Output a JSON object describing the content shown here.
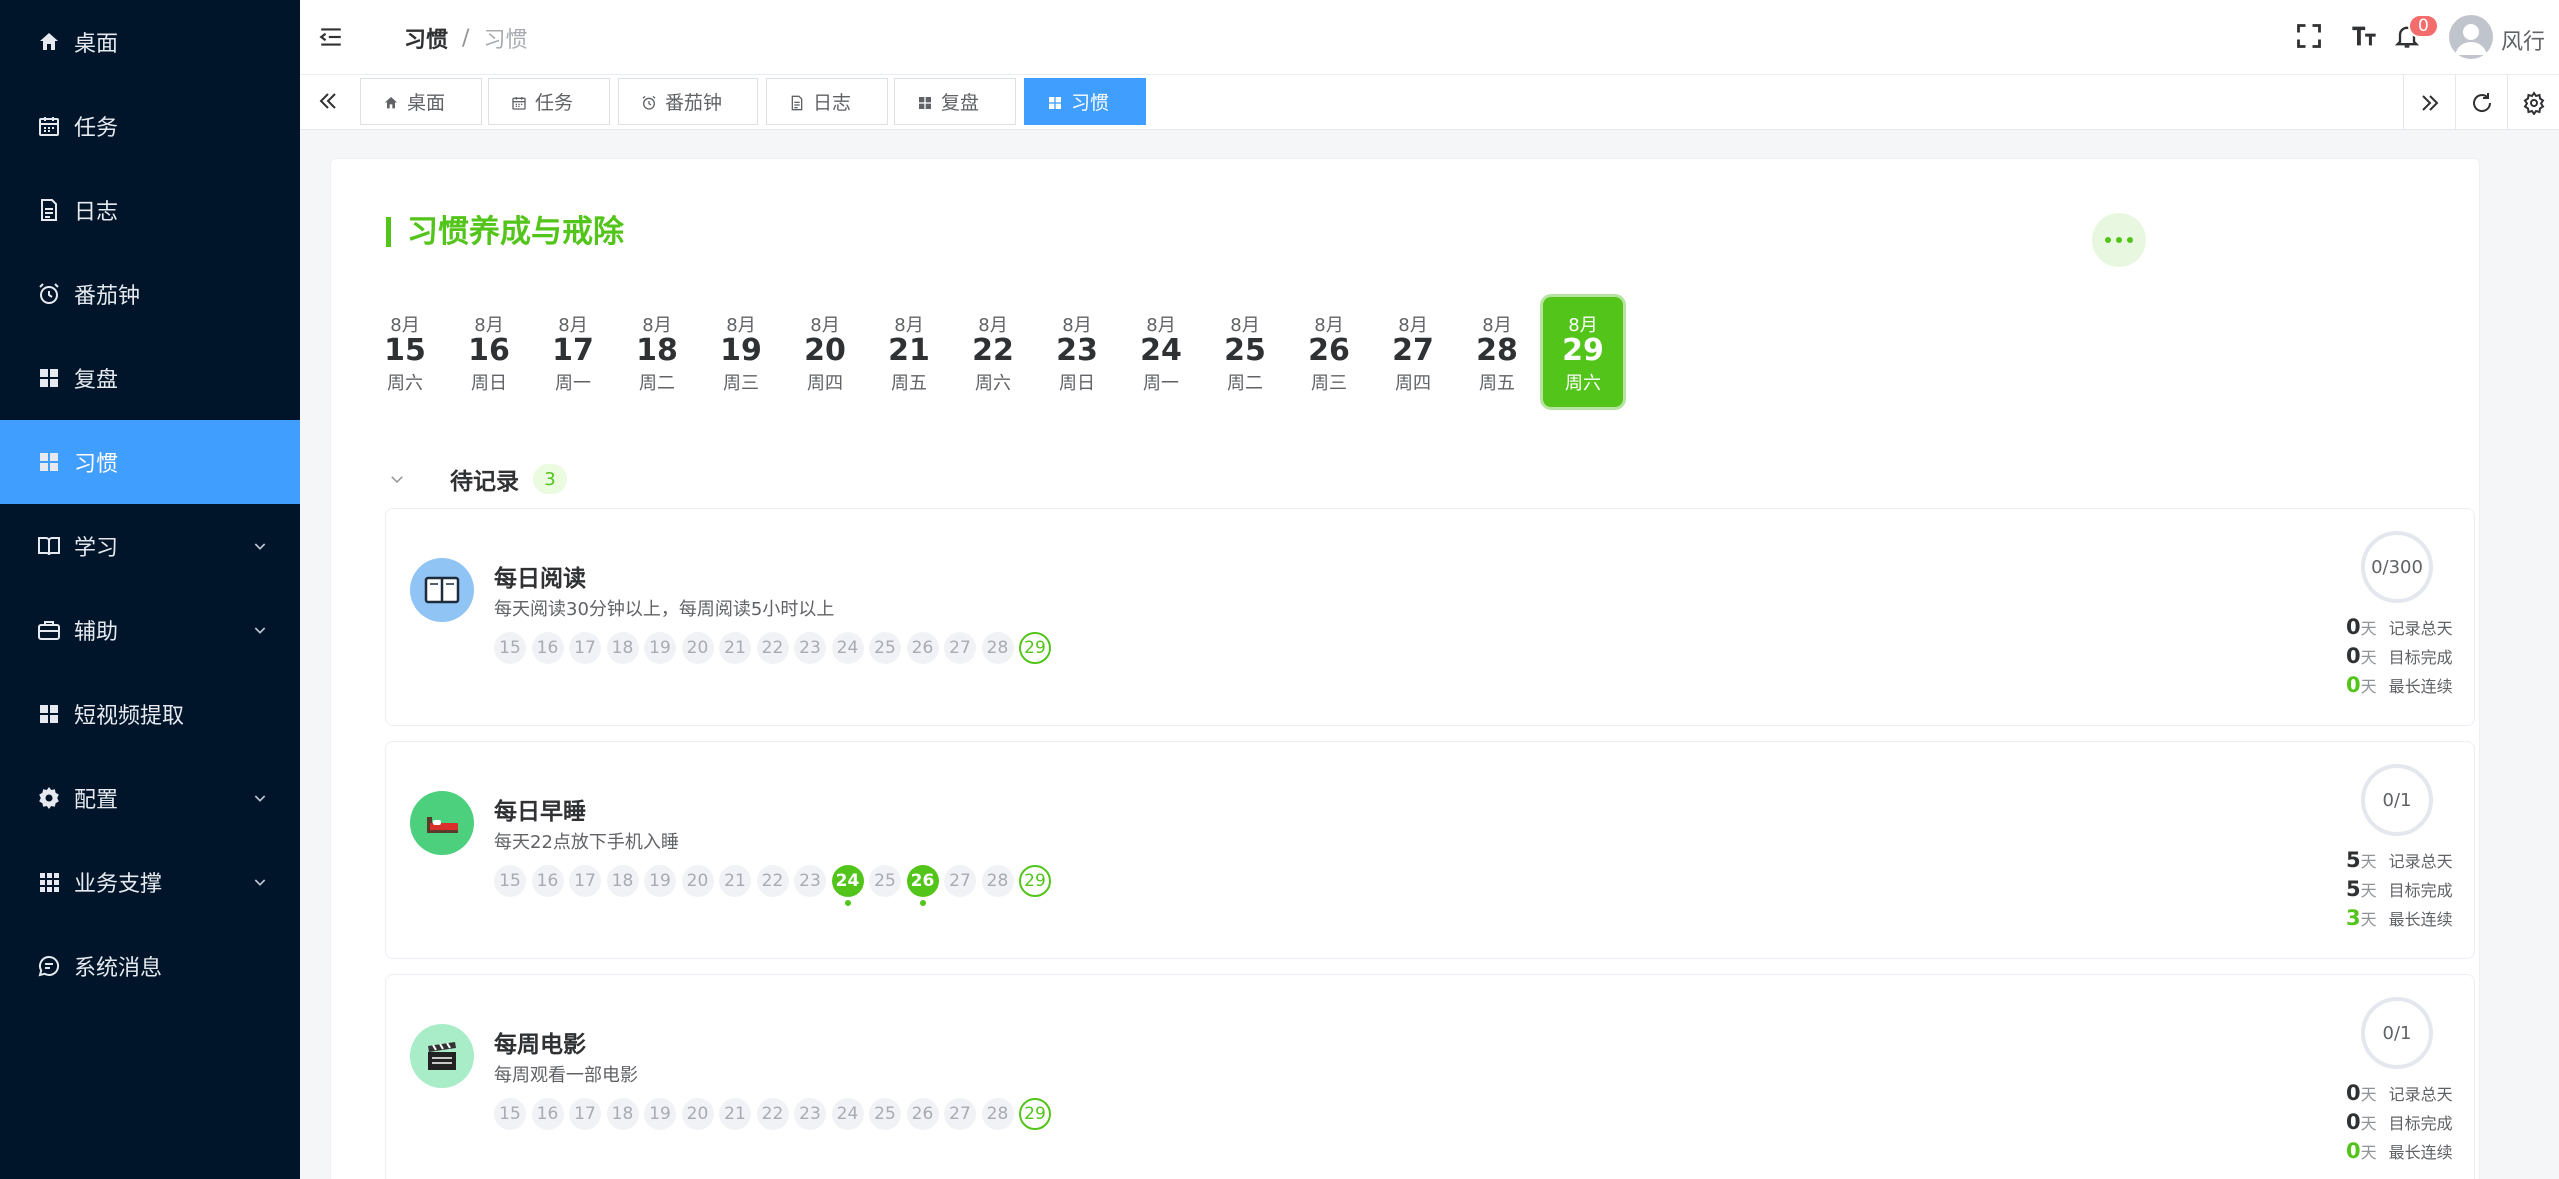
{
  "sidebar": {
    "items": [
      {
        "label": "桌面",
        "icon": "home-icon",
        "active": false,
        "expandable": false
      },
      {
        "label": "任务",
        "icon": "calendar-icon",
        "active": false,
        "expandable": false
      },
      {
        "label": "日志",
        "icon": "document-icon",
        "active": false,
        "expandable": false
      },
      {
        "label": "番茄钟",
        "icon": "alarm-clock-icon",
        "active": false,
        "expandable": false
      },
      {
        "label": "复盘",
        "icon": "grid-icon",
        "active": false,
        "expandable": false
      },
      {
        "label": "习惯",
        "icon": "grid-icon",
        "active": true,
        "expandable": false
      },
      {
        "label": "学习",
        "icon": "book-icon",
        "active": false,
        "expandable": true
      },
      {
        "label": "辅助",
        "icon": "briefcase-icon",
        "active": false,
        "expandable": true
      },
      {
        "label": "短视频提取",
        "icon": "grid-icon",
        "active": false,
        "expandable": false
      },
      {
        "label": "配置",
        "icon": "gear-icon",
        "active": false,
        "expandable": true
      },
      {
        "label": "业务支撑",
        "icon": "apps-icon",
        "active": false,
        "expandable": true
      },
      {
        "label": "系统消息",
        "icon": "chat-icon",
        "active": false,
        "expandable": false
      }
    ]
  },
  "header": {
    "breadcrumb_current": "习惯",
    "breadcrumb_separator": "/",
    "breadcrumb_last": "习惯",
    "notification_count": "0",
    "user_name": "风行"
  },
  "tabs": [
    {
      "label": "桌面",
      "icon": "home-icon",
      "active": false
    },
    {
      "label": "任务",
      "icon": "calendar-icon",
      "active": false
    },
    {
      "label": "番茄钟",
      "icon": "alarm-clock-icon",
      "active": false
    },
    {
      "label": "日志",
      "icon": "document-icon",
      "active": false
    },
    {
      "label": "复盘",
      "icon": "grid-icon",
      "active": false
    },
    {
      "label": "习惯",
      "icon": "grid-icon",
      "active": true
    }
  ],
  "main": {
    "title": "习惯养成与戒除",
    "dates": [
      {
        "month": "8月",
        "day": "15",
        "weekday": "周六",
        "selected": false
      },
      {
        "month": "8月",
        "day": "16",
        "weekday": "周日",
        "selected": false
      },
      {
        "month": "8月",
        "day": "17",
        "weekday": "周一",
        "selected": false
      },
      {
        "month": "8月",
        "day": "18",
        "weekday": "周二",
        "selected": false
      },
      {
        "month": "8月",
        "day": "19",
        "weekday": "周三",
        "selected": false
      },
      {
        "month": "8月",
        "day": "20",
        "weekday": "周四",
        "selected": false
      },
      {
        "month": "8月",
        "day": "21",
        "weekday": "周五",
        "selected": false
      },
      {
        "month": "8月",
        "day": "22",
        "weekday": "周六",
        "selected": false
      },
      {
        "month": "8月",
        "day": "23",
        "weekday": "周日",
        "selected": false
      },
      {
        "month": "8月",
        "day": "24",
        "weekday": "周一",
        "selected": false
      },
      {
        "month": "8月",
        "day": "25",
        "weekday": "周二",
        "selected": false
      },
      {
        "month": "8月",
        "day": "26",
        "weekday": "周三",
        "selected": false
      },
      {
        "month": "8月",
        "day": "27",
        "weekday": "周四",
        "selected": false
      },
      {
        "month": "8月",
        "day": "28",
        "weekday": "周五",
        "selected": false
      },
      {
        "month": "8月",
        "day": "29",
        "weekday": "周六",
        "selected": true
      }
    ],
    "section": {
      "title": "待记录",
      "count": "3"
    },
    "habits": [
      {
        "name": "每日阅读",
        "description": "每天阅读30分钟以上，每周阅读5小时以上",
        "icon": "book-icon",
        "icon_color": "#8fc4f5",
        "progress": "0/300",
        "days": [
          "15",
          "16",
          "17",
          "18",
          "19",
          "20",
          "21",
          "22",
          "23",
          "24",
          "25",
          "26",
          "27",
          "28",
          "29"
        ],
        "done_days": [],
        "today": "29",
        "stats": [
          {
            "value": "0",
            "unit": "天",
            "label": "记录总天",
            "green": false
          },
          {
            "value": "0",
            "unit": "天",
            "label": "目标完成",
            "green": false
          },
          {
            "value": "0",
            "unit": "天",
            "label": "最长连续",
            "green": true
          }
        ]
      },
      {
        "name": "每日早睡",
        "description": "每天22点放下手机入睡",
        "icon": "bed-icon",
        "icon_color": "#4cd07d",
        "progress": "0/1",
        "days": [
          "15",
          "16",
          "17",
          "18",
          "19",
          "20",
          "21",
          "22",
          "23",
          "24",
          "25",
          "26",
          "27",
          "28",
          "29"
        ],
        "done_days": [
          "24",
          "26"
        ],
        "today": "29",
        "stats": [
          {
            "value": "5",
            "unit": "天",
            "label": "记录总天",
            "green": false
          },
          {
            "value": "5",
            "unit": "天",
            "label": "目标完成",
            "green": false
          },
          {
            "value": "3",
            "unit": "天",
            "label": "最长连续",
            "green": true
          }
        ]
      },
      {
        "name": "每周电影",
        "description": "每周观看一部电影",
        "icon": "clapperboard-icon",
        "icon_color": "#a8ecc8",
        "progress": "0/1",
        "days": [
          "15",
          "16",
          "17",
          "18",
          "19",
          "20",
          "21",
          "22",
          "23",
          "24",
          "25",
          "26",
          "27",
          "28",
          "29"
        ],
        "done_days": [],
        "today": "29",
        "stats": [
          {
            "value": "0",
            "unit": "天",
            "label": "记录总天",
            "green": false
          },
          {
            "value": "0",
            "unit": "天",
            "label": "目标完成",
            "green": false
          },
          {
            "value": "0",
            "unit": "天",
            "label": "最长连续",
            "green": true
          }
        ]
      }
    ]
  }
}
